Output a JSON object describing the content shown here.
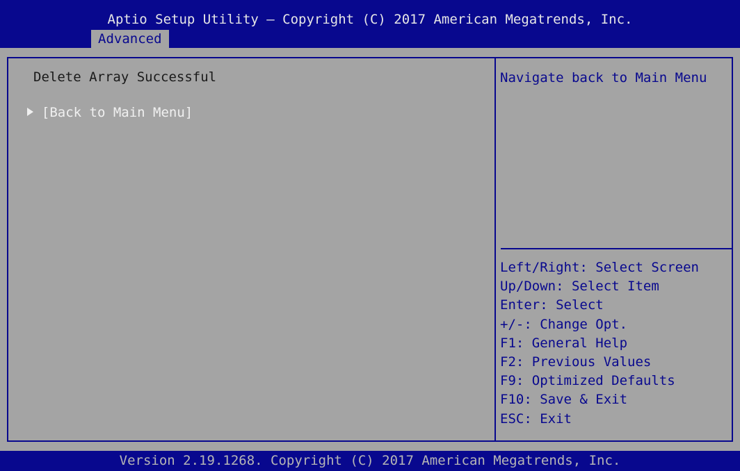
{
  "header": {
    "title": "Aptio Setup Utility – Copyright (C) 2017 American Megatrends, Inc.",
    "active_tab": "Advanced"
  },
  "main": {
    "status": "Delete Array Successful",
    "items": [
      {
        "label": "[Back to Main Menu]",
        "icon": "right-triangle-icon"
      }
    ]
  },
  "help": {
    "text": "Navigate back to Main Menu"
  },
  "keys": [
    "Left/Right: Select Screen",
    "Up/Down: Select Item",
    "Enter: Select",
    "+/-: Change Opt.",
    "F1: General Help",
    "F2: Previous Values",
    "F9: Optimized Defaults",
    "F10: Save & Exit",
    "ESC: Exit"
  ],
  "footer": {
    "text": "Version 2.19.1268. Copyright (C) 2017 American Megatrends, Inc."
  },
  "colors": {
    "bios_blue": "#08088e",
    "background_gray": "#a4a4a4",
    "highlight_white": "#f0f0f0"
  }
}
